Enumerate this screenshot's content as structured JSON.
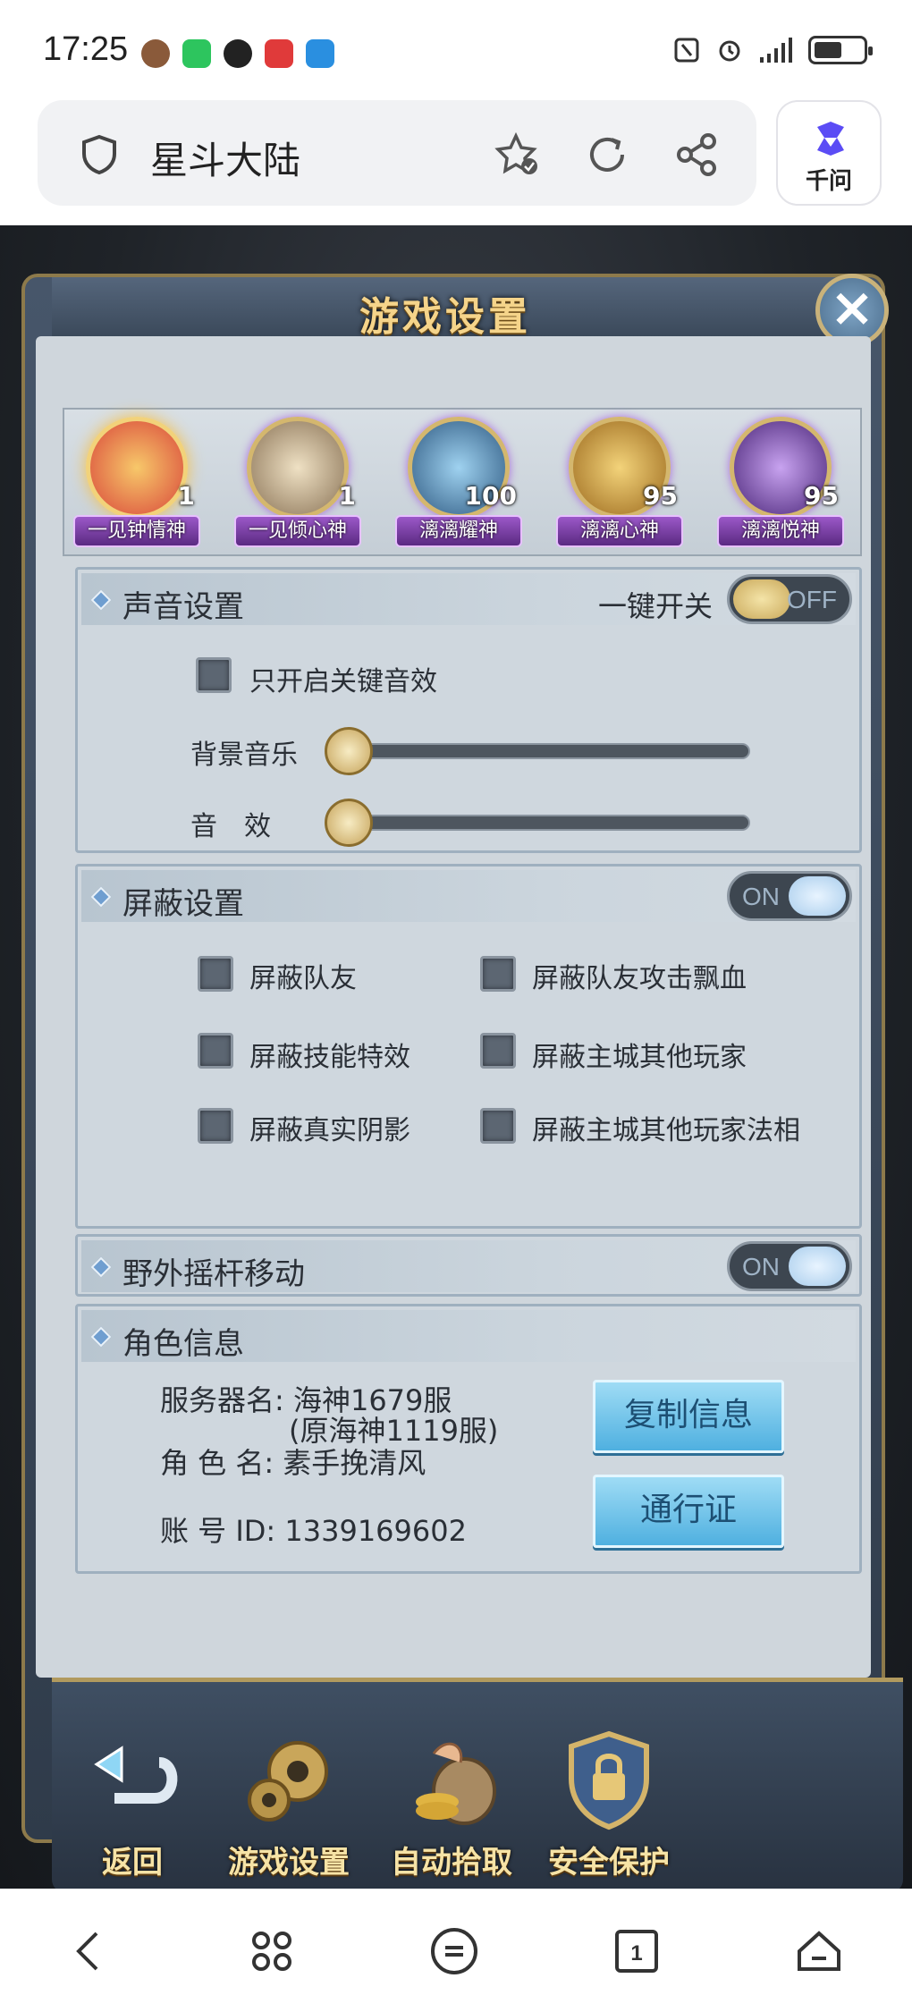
{
  "status_bar": {
    "time": "17:25"
  },
  "browser": {
    "page_title": "星斗大陆",
    "ai_label": "千问"
  },
  "panel": {
    "title": "游戏设置"
  },
  "gods": [
    {
      "name": "一见钟情神",
      "level": "1",
      "color": "#d9473a"
    },
    {
      "name": "一见倾心神",
      "level": "1",
      "color": "#c9b08a"
    },
    {
      "name": "漓漓耀神",
      "level": "100",
      "color": "#3f6f9a"
    },
    {
      "name": "漓漓心神",
      "level": "95",
      "color": "#c99a3a"
    },
    {
      "name": "漓漓悦神",
      "level": "95",
      "color": "#6a3fa0"
    }
  ],
  "sound": {
    "title": "声音设置",
    "onekey_label": "一键开关",
    "toggle_state": "OFF",
    "key_sound_only": "只开启关键音效",
    "bgm_label": "背景音乐",
    "bgm_level": 0,
    "sfx_label": "音　效",
    "sfx_level": 0
  },
  "shield": {
    "title": "屏蔽设置",
    "toggle_state": "ON",
    "options": [
      "屏蔽队友",
      "屏蔽队友攻击飘血",
      "屏蔽技能特效",
      "屏蔽主城其他玩家",
      "屏蔽真实阴影",
      "屏蔽主城其他玩家法相"
    ]
  },
  "joystick": {
    "title": "野外摇杆移动",
    "toggle_state": "ON"
  },
  "role": {
    "title": "角色信息",
    "server_line1": "服务器名:  海神1679服",
    "server_line2": "(原海神1119服)",
    "role_name_line": "角 色 名:  素手挽清风",
    "account_line": "账 号 ID:  1339169602",
    "copy_button": "复制信息",
    "pass_button": "通行证"
  },
  "bottom_nav": {
    "back": "返回",
    "game_settings": "游戏设置",
    "auto_pickup": "自动拾取",
    "security": "安全保护"
  },
  "colors": {
    "accent_gold": "#f5d48a",
    "panel_bg": "#cfd6dc",
    "button_blue": "#4fb0e0"
  }
}
